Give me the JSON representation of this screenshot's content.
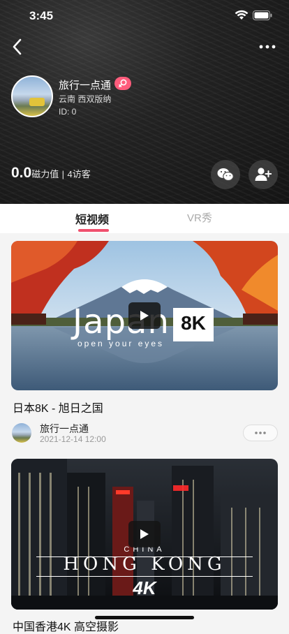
{
  "status_bar": {
    "time": "3:45"
  },
  "profile": {
    "name": "旅行一点通",
    "location": "云南 西双版纳",
    "id_text": "ID: 0",
    "magnet_value": "0.0",
    "magnet_label": "磁力值",
    "separator": "|",
    "visitors": "4访客"
  },
  "tabs": [
    {
      "label": "短视频",
      "active": true
    },
    {
      "label": "VR秀",
      "active": false
    }
  ],
  "videos": [
    {
      "title": "日本8K - 旭日之国",
      "author": "旅行一点通",
      "date": "2021-12-14 12:00",
      "thumb_text_main": "Japan",
      "thumb_text_badge": "8K",
      "thumb_text_sub": "open your eyes"
    },
    {
      "title": "中国香港4K 高空摄影",
      "thumb_text_top": "China",
      "thumb_text_main": "HONG KONG",
      "thumb_text_badge": "4K"
    }
  ],
  "icons": {
    "back": "chevron-left-icon",
    "more": "more-horizontal-icon",
    "badge": "female-symbol-icon",
    "wechat": "wechat-icon",
    "add_friend": "add-user-icon",
    "play": "play-icon"
  },
  "colors": {
    "accent": "#f0506e",
    "badge_bg": "#ff5c7c"
  }
}
